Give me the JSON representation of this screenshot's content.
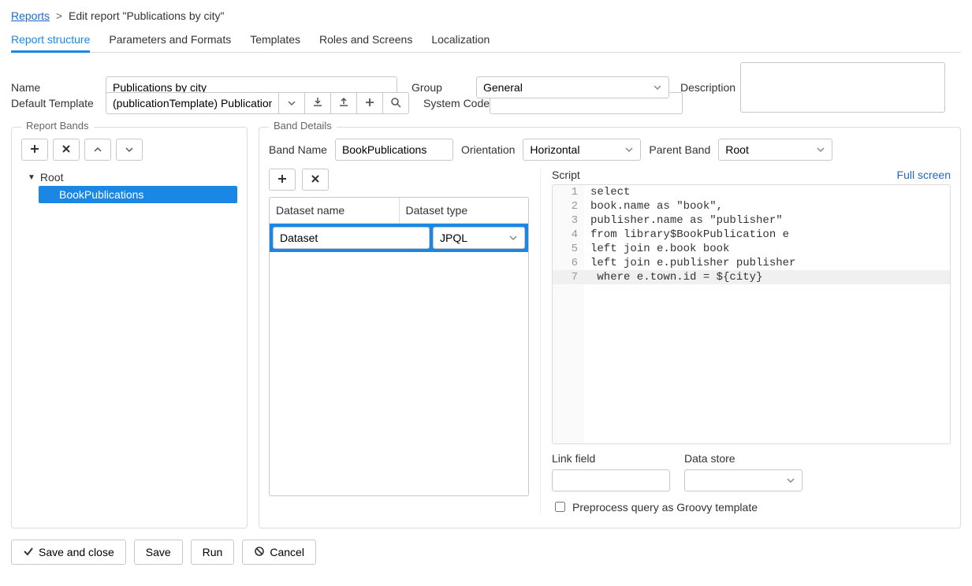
{
  "breadcrumb": {
    "root": "Reports",
    "current": "Edit report \"Publications by city\""
  },
  "tabs": [
    {
      "label": "Report structure",
      "active": true
    },
    {
      "label": "Parameters and Formats",
      "active": false
    },
    {
      "label": "Templates",
      "active": false
    },
    {
      "label": "Roles and Screens",
      "active": false
    },
    {
      "label": "Localization",
      "active": false
    }
  ],
  "form": {
    "name_label": "Name",
    "name_value": "Publications by city",
    "group_label": "Group",
    "group_value": "General",
    "description_label": "Description",
    "description_value": "",
    "default_template_label": "Default Template",
    "default_template_value": "(publicationTemplate) Publication",
    "system_code_label": "System Code",
    "system_code_value": ""
  },
  "left": {
    "legend": "Report Bands",
    "tree": {
      "root": "Root",
      "child": "BookPublications"
    }
  },
  "right": {
    "legend": "Band Details",
    "band_name_label": "Band Name",
    "band_name_value": "BookPublications",
    "orientation_label": "Orientation",
    "orientation_value": "Horizontal",
    "parent_band_label": "Parent Band",
    "parent_band_value": "Root",
    "dataset_name_header": "Dataset name",
    "dataset_type_header": "Dataset type",
    "dataset_name_value": "Dataset",
    "dataset_type_value": "JPQL",
    "script_label": "Script",
    "full_screen_label": "Full screen",
    "script_lines": [
      {
        "n": 1,
        "text": "select"
      },
      {
        "n": 2,
        "text": "book.name as \"book\","
      },
      {
        "n": 3,
        "text": "publisher.name as \"publisher\""
      },
      {
        "n": 4,
        "text": "from library$BookPublication e"
      },
      {
        "n": 5,
        "text": "left join e.book book"
      },
      {
        "n": 6,
        "text": "left join e.publisher publisher"
      },
      {
        "n": 7,
        "text": " where e.town.id = ${city}"
      }
    ],
    "link_field_label": "Link field",
    "link_field_value": "",
    "data_store_label": "Data store",
    "data_store_value": "",
    "preprocess_label": "Preprocess query as Groovy template"
  },
  "buttons": {
    "save_close": "Save and close",
    "save": "Save",
    "run": "Run",
    "cancel": "Cancel"
  }
}
